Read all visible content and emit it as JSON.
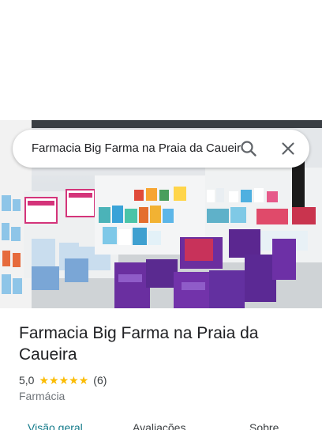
{
  "search": {
    "query": "Farmacia Big Farma na Praia da Caueira"
  },
  "photo": {
    "signs": [
      "AVISO FIADO!",
      "AVISO BALCÃO",
      "LUXE FULL"
    ]
  },
  "place": {
    "title": "Farmacia Big Farma na Praia da Caueira",
    "rating": "5,0",
    "stars": 5,
    "review_count": "(6)",
    "category": "Farmácia"
  },
  "tabs": [
    {
      "label": "Visão geral",
      "active": true
    },
    {
      "label": "Avaliações",
      "active": false
    },
    {
      "label": "Sobre",
      "active": false
    }
  ],
  "colors": {
    "star": "#fbbc04",
    "active_tab": "#137a8a"
  }
}
